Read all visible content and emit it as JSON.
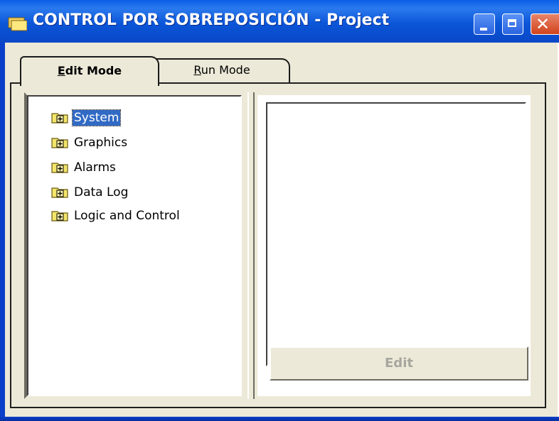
{
  "window": {
    "title": "CONTROL POR SOBREPOSICIÓN - Project",
    "app_icon": "folders-icon",
    "controls": {
      "minimize": "minimize-icon",
      "maximize": "maximize-icon",
      "close": "close-icon"
    }
  },
  "tabs": [
    {
      "label": "Edit Mode",
      "mnemonic": "E",
      "rest": "dit Mode",
      "selected": true
    },
    {
      "label": "Run Mode",
      "mnemonic": "R",
      "rest": "un Mode",
      "selected": false
    }
  ],
  "tree": {
    "items": [
      {
        "label": "System",
        "icon": "folder-plus-icon",
        "selected": true
      },
      {
        "label": "Graphics",
        "icon": "folder-plus-icon",
        "selected": false
      },
      {
        "label": "Alarms",
        "icon": "folder-plus-icon",
        "selected": false
      },
      {
        "label": "Data Log",
        "icon": "folder-plus-icon",
        "selected": false
      },
      {
        "label": "Logic and Control",
        "icon": "folder-plus-icon",
        "selected": false
      }
    ]
  },
  "detail": {
    "edit_button": {
      "label": "Edit",
      "enabled": false
    }
  },
  "colors": {
    "titlebar": "#0a5fe6",
    "face": "#ece9d8",
    "selection": "#316ac5",
    "folder": "#f2e56b",
    "disabled_text": "#a7a69e"
  }
}
